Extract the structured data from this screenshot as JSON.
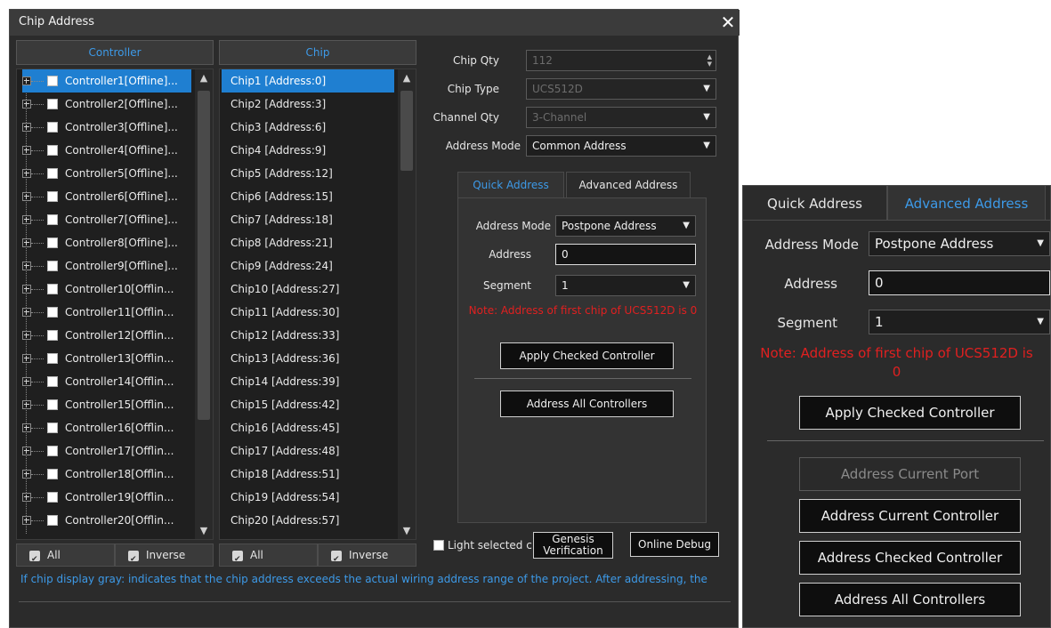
{
  "window": {
    "title": "Chip Address",
    "close_glyph": "✕"
  },
  "controller_panel": {
    "header": "Controller",
    "items": [
      "Controller1[Offline]...",
      "Controller2[Offline]...",
      "Controller3[Offline]...",
      "Controller4[Offline]...",
      "Controller5[Offline]...",
      "Controller6[Offline]...",
      "Controller7[Offline]...",
      "Controller8[Offline]...",
      "Controller9[Offline]...",
      "Controller10[Offlin...",
      "Controller11[Offlin...",
      "Controller12[Offlin...",
      "Controller13[Offlin...",
      "Controller14[Offlin...",
      "Controller15[Offlin...",
      "Controller16[Offlin...",
      "Controller17[Offlin...",
      "Controller18[Offlin...",
      "Controller19[Offlin...",
      "Controller20[Offlin..."
    ],
    "all_label": "All",
    "inverse_label": "Inverse"
  },
  "chip_panel": {
    "header": "Chip",
    "items": [
      "Chip1 [Address:0]",
      "Chip2 [Address:3]",
      "Chip3 [Address:6]",
      "Chip4 [Address:9]",
      "Chip5 [Address:12]",
      "Chip6 [Address:15]",
      "Chip7 [Address:18]",
      "Chip8 [Address:21]",
      "Chip9 [Address:24]",
      "Chip10 [Address:27]",
      "Chip11 [Address:30]",
      "Chip12 [Address:33]",
      "Chip13 [Address:36]",
      "Chip14 [Address:39]",
      "Chip15 [Address:42]",
      "Chip16 [Address:45]",
      "Chip17 [Address:48]",
      "Chip18 [Address:51]",
      "Chip19 [Address:54]",
      "Chip20 [Address:57]"
    ],
    "all_label": "All",
    "inverse_label": "Inverse"
  },
  "settings": {
    "chip_qty_label": "Chip Qty",
    "chip_qty_value": "112",
    "chip_type_label": "Chip Type",
    "chip_type_value": "UCS512D",
    "channel_qty_label": "Channel Qty",
    "channel_qty_value": "3-Channel",
    "address_mode_label": "Address Mode",
    "address_mode_value": "Common Address"
  },
  "quick_tab": {
    "tab_quick": "Quick Address",
    "tab_advanced": "Advanced Address",
    "address_mode_label": "Address Mode",
    "address_mode_value": "Postpone Address",
    "address_label": "Address",
    "address_value": "0",
    "segment_label": "Segment",
    "segment_value": "1",
    "note": "Note: Address of first chip of UCS512D is 0",
    "apply_checked": "Apply Checked Controller",
    "address_all": "Address All Controllers"
  },
  "bottom": {
    "light_selected": "Light selected c",
    "genesis_line1": "Genesis",
    "genesis_line2": "Verification",
    "online_debug": "Online Debug",
    "info": "If chip display gray: indicates that the chip address exceeds the actual wiring address range of the project. After addressing, the"
  },
  "advanced_panel": {
    "tab_quick": "Quick Address",
    "tab_advanced": "Advanced Address",
    "address_mode_label": "Address Mode",
    "address_mode_value": "Postpone Address",
    "address_label": "Address",
    "address_value": "0",
    "segment_label": "Segment",
    "segment_value": "1",
    "note_line1": "Note: Address of first chip of UCS512D is",
    "note_line2": "0",
    "apply_checked": "Apply Checked Controller",
    "address_current_port": "Address Current Port",
    "address_current_controller": "Address Current Controller",
    "address_checked_controller": "Address Checked Controller",
    "address_all": "Address All Controllers"
  },
  "colors": {
    "accent": "#3d9ae8",
    "selected": "#1f7fd1",
    "note": "#e02020",
    "bg": "#2b2b2b"
  }
}
